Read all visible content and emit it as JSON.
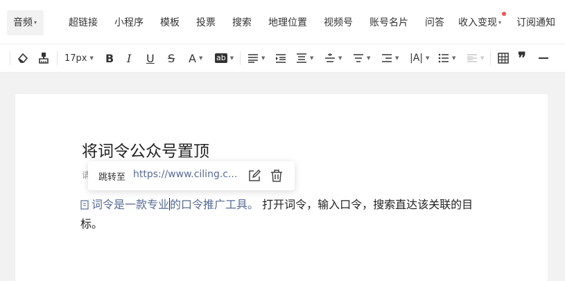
{
  "insert_bar": {
    "items": [
      {
        "label": "音频",
        "has_dropdown": true
      },
      {
        "label": "超链接"
      },
      {
        "label": "小程序"
      },
      {
        "label": "模板"
      },
      {
        "label": "投票"
      },
      {
        "label": "搜索"
      },
      {
        "label": "地理位置"
      },
      {
        "label": "视频号"
      },
      {
        "label": "账号名片"
      },
      {
        "label": "问答"
      },
      {
        "label": "收入变现",
        "has_dropdown": true,
        "badge_color": "#fa5151"
      },
      {
        "label": "订阅通知"
      }
    ]
  },
  "format_toolbar": {
    "font_size": "17px",
    "icons": [
      "format-eraser-icon",
      "format-painter-icon",
      "bold-icon",
      "italic-icon",
      "underline-icon",
      "strikethrough-icon",
      "font-color-icon",
      "highlight-icon",
      "align-icon",
      "indent-icon",
      "line-height-icon",
      "paragraph-spacing-before-icon",
      "paragraph-spacing-after-icon",
      "text-indent-icon",
      "letter-spacing-icon",
      "list-icon",
      "border-icon",
      "table-icon",
      "quote-icon",
      "divider-icon"
    ],
    "bold_label": "B",
    "italic_label": "I",
    "underline_label": "U",
    "strike_label": "S",
    "font_color_label": "A",
    "highlight_label": "ab"
  },
  "editor": {
    "title": "将词令公众号置顶",
    "partial_text": "请",
    "paragraph": {
      "link_text_before_cursor": "词令是一款专业",
      "link_text_after_cursor": "的口令推广工具。",
      "plain_text": " 打开词令，输入口令，搜索直达该关联的目标。"
    }
  },
  "link_popover": {
    "label": "跳转至",
    "url": "https://www.ciling.c..."
  },
  "colors": {
    "link": "#576b95",
    "badge": "#fa5151",
    "workspace_bg": "#f2f2f2"
  }
}
